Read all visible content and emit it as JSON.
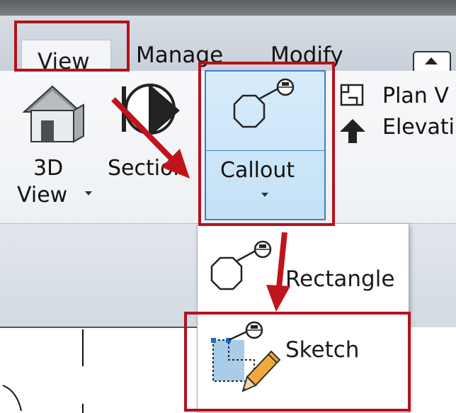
{
  "tabs": [
    {
      "label": "View",
      "active": true
    },
    {
      "label": "Manage",
      "active": false
    },
    {
      "label": "Modify",
      "active": false
    }
  ],
  "ribbon": {
    "view_3d_label_line1": "3D",
    "view_3d_label_line2": "View",
    "section_label": "Section",
    "callout_label": "Callout",
    "plan_views_label": "Plan V",
    "elevation_label": "Elevati"
  },
  "callout_menu": {
    "items": [
      {
        "label": "Rectangle"
      },
      {
        "label": "Sketch"
      }
    ]
  },
  "colors": {
    "highlight_red": "#b3121c",
    "arrow_red": "#c0141c",
    "callout_selected": "#c4e1f6",
    "callout_border": "#3d7fc7"
  },
  "icons": [
    "house-icon",
    "section-icon",
    "callout-icon",
    "plan-views-icon",
    "elevation-icon",
    "callout-rectangle-icon",
    "callout-sketch-icon",
    "pencil-icon"
  ]
}
